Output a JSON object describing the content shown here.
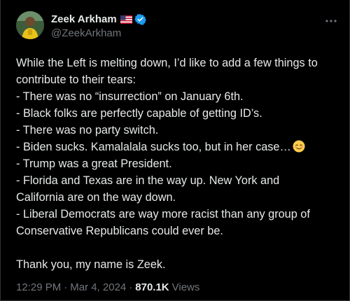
{
  "author": {
    "display_name": "Zeek Arkham",
    "handle": "@ZeekArkham",
    "flag_icon": "us-flag-icon",
    "verified_icon": "verified-badge-icon",
    "verified_color": "#1d9bf0"
  },
  "tweet": {
    "lines": [
      "While the Left is melting down, I’d like to add a few things to",
      "contribute to their tears:",
      "- There was no “insurrection” on January 6th.",
      "- Black folks are perfectly capable of getting ID’s.",
      "- There was no party switch.",
      "- Biden sucks. Kamalalala sucks too, but in her case…",
      "- Trump was a great President.",
      "- Florida and Texas are in the way up. New York and",
      "California are on the way down.",
      "- Liberal Democrats are way more racist than any group of",
      "Conservative Republicans could ever be.",
      "",
      "Thank you, my name is Zeek."
    ],
    "emoji_icon": "relieved-face-emoji-icon"
  },
  "meta": {
    "time": "12:29 PM",
    "separator": "·",
    "date": "Mar 4, 2024",
    "views_count": "870.1K",
    "views_label": "Views"
  },
  "colors": {
    "background": "#000000",
    "text": "#e7e9ea",
    "secondary": "#71767b",
    "border": "#2f3336"
  }
}
